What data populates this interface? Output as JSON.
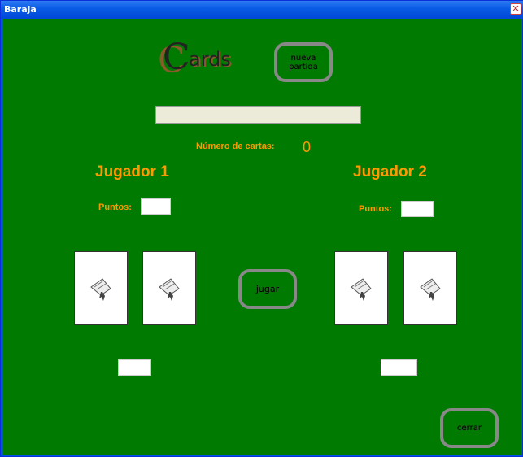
{
  "window": {
    "title": "Baraja",
    "close_glyph": "✕"
  },
  "logo": {
    "first_letter": "C",
    "rest": "ards"
  },
  "buttons": {
    "nueva": "nueva partida",
    "jugar": "jugar",
    "cerrar": "cerrar"
  },
  "status_bar": {
    "value": ""
  },
  "deck": {
    "label": "Número de cartas:",
    "count": "0"
  },
  "player1": {
    "title": "Jugador 1",
    "points_label": "Puntos:",
    "points_value": "",
    "total_value": "",
    "cards": [
      "card-back",
      "card-back"
    ]
  },
  "player2": {
    "title": "Jugador 2",
    "points_label": "Puntos:",
    "points_value": "",
    "total_value": "",
    "cards": [
      "card-back",
      "card-back"
    ]
  },
  "colors": {
    "table_green": "#007a00",
    "label_orange": "#ff9900",
    "button_border": "#888888"
  }
}
